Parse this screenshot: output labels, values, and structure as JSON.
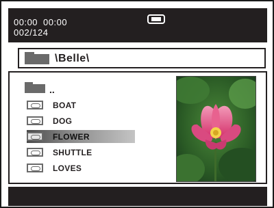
{
  "status": {
    "elapsed_time": "00:00",
    "total_time": "00:00",
    "track_counter": "002/124",
    "battery_icon": "battery-icon"
  },
  "path": {
    "folder_icon": "folder-icon",
    "current_path": "\\Belle\\"
  },
  "browser": {
    "parent_label": "..",
    "items": [
      {
        "name": "BOAT",
        "icon": "image-file-icon",
        "selected": false
      },
      {
        "name": "DOG",
        "icon": "image-file-icon",
        "selected": false
      },
      {
        "name": "FLOWER",
        "icon": "image-file-icon",
        "selected": true
      },
      {
        "name": "SHUTTLE",
        "icon": "image-file-icon",
        "selected": false
      },
      {
        "name": "LOVES",
        "icon": "image-file-icon",
        "selected": false
      }
    ]
  },
  "preview": {
    "subject": "lotus-flower-thumbnail"
  },
  "colors": {
    "bar_background": "#231f20",
    "folder_grey": "#6a6a6a",
    "preview_leaf": "#2f6b2a",
    "preview_petal": "#e0457a"
  }
}
